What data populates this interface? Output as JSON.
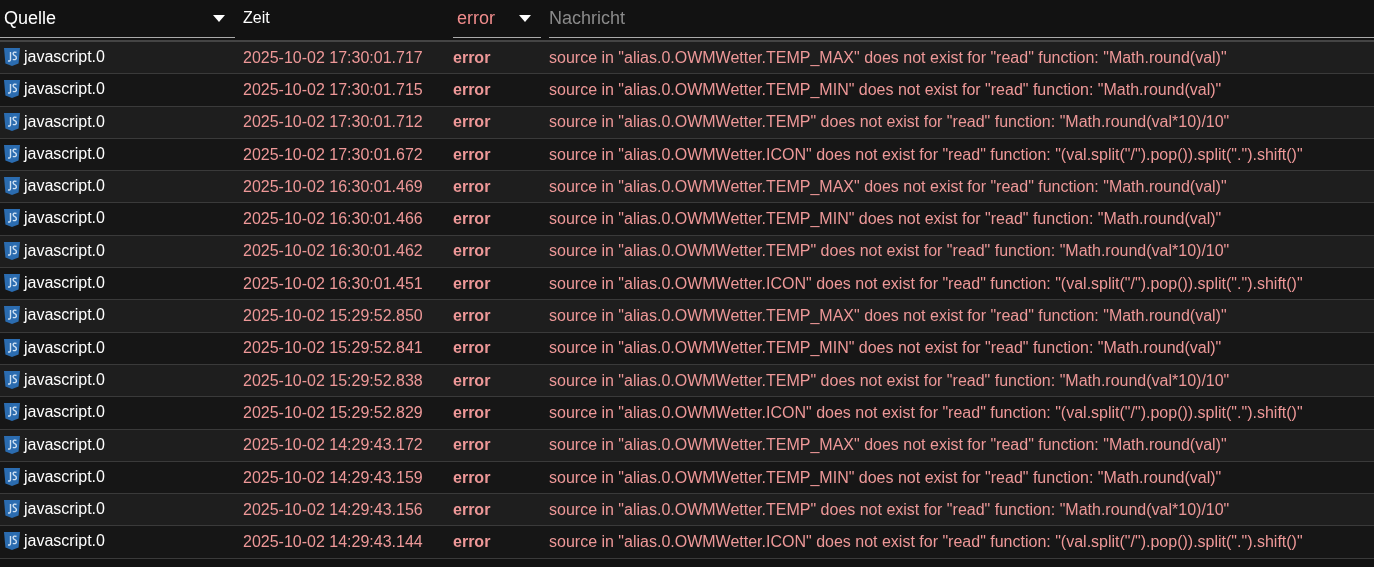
{
  "filters": {
    "source": {
      "value": "Quelle"
    },
    "time": {
      "label": "Zeit"
    },
    "severity": {
      "value": "error"
    },
    "message": {
      "placeholder": "Nachricht"
    }
  },
  "rows": [
    {
      "source": "javascript.0",
      "time": "2025-10-02 17:30:01.717",
      "severity": "error",
      "message": "source in \"alias.0.OWMWetter.TEMP_MAX\" does not exist for \"read\" function: \"Math.round(val)\""
    },
    {
      "source": "javascript.0",
      "time": "2025-10-02 17:30:01.715",
      "severity": "error",
      "message": "source in \"alias.0.OWMWetter.TEMP_MIN\" does not exist for \"read\" function: \"Math.round(val)\""
    },
    {
      "source": "javascript.0",
      "time": "2025-10-02 17:30:01.712",
      "severity": "error",
      "message": "source in \"alias.0.OWMWetter.TEMP\" does not exist for \"read\" function: \"Math.round(val*10)/10\""
    },
    {
      "source": "javascript.0",
      "time": "2025-10-02 17:30:01.672",
      "severity": "error",
      "message": "source in \"alias.0.OWMWetter.ICON\" does not exist for \"read\" function: \"(val.split(\"/\").pop()).split(\".\").shift()\""
    },
    {
      "source": "javascript.0",
      "time": "2025-10-02 16:30:01.469",
      "severity": "error",
      "message": "source in \"alias.0.OWMWetter.TEMP_MAX\" does not exist for \"read\" function: \"Math.round(val)\""
    },
    {
      "source": "javascript.0",
      "time": "2025-10-02 16:30:01.466",
      "severity": "error",
      "message": "source in \"alias.0.OWMWetter.TEMP_MIN\" does not exist for \"read\" function: \"Math.round(val)\""
    },
    {
      "source": "javascript.0",
      "time": "2025-10-02 16:30:01.462",
      "severity": "error",
      "message": "source in \"alias.0.OWMWetter.TEMP\" does not exist for \"read\" function: \"Math.round(val*10)/10\""
    },
    {
      "source": "javascript.0",
      "time": "2025-10-02 16:30:01.451",
      "severity": "error",
      "message": "source in \"alias.0.OWMWetter.ICON\" does not exist for \"read\" function: \"(val.split(\"/\").pop()).split(\".\").shift()\""
    },
    {
      "source": "javascript.0",
      "time": "2025-10-02 15:29:52.850",
      "severity": "error",
      "message": "source in \"alias.0.OWMWetter.TEMP_MAX\" does not exist for \"read\" function: \"Math.round(val)\""
    },
    {
      "source": "javascript.0",
      "time": "2025-10-02 15:29:52.841",
      "severity": "error",
      "message": "source in \"alias.0.OWMWetter.TEMP_MIN\" does not exist for \"read\" function: \"Math.round(val)\""
    },
    {
      "source": "javascript.0",
      "time": "2025-10-02 15:29:52.838",
      "severity": "error",
      "message": "source in \"alias.0.OWMWetter.TEMP\" does not exist for \"read\" function: \"Math.round(val*10)/10\""
    },
    {
      "source": "javascript.0",
      "time": "2025-10-02 15:29:52.829",
      "severity": "error",
      "message": "source in \"alias.0.OWMWetter.ICON\" does not exist for \"read\" function: \"(val.split(\"/\").pop()).split(\".\").shift()\""
    },
    {
      "source": "javascript.0",
      "time": "2025-10-02 14:29:43.172",
      "severity": "error",
      "message": "source in \"alias.0.OWMWetter.TEMP_MAX\" does not exist for \"read\" function: \"Math.round(val)\""
    },
    {
      "source": "javascript.0",
      "time": "2025-10-02 14:29:43.159",
      "severity": "error",
      "message": "source in \"alias.0.OWMWetter.TEMP_MIN\" does not exist for \"read\" function: \"Math.round(val)\""
    },
    {
      "source": "javascript.0",
      "time": "2025-10-02 14:29:43.156",
      "severity": "error",
      "message": "source in \"alias.0.OWMWetter.TEMP\" does not exist for \"read\" function: \"Math.round(val*10)/10\""
    },
    {
      "source": "javascript.0",
      "time": "2025-10-02 14:29:43.144",
      "severity": "error",
      "message": "source in \"alias.0.OWMWetter.ICON\" does not exist for \"read\" function: \"(val.split(\"/\").pop()).split(\".\").shift()\""
    }
  ]
}
